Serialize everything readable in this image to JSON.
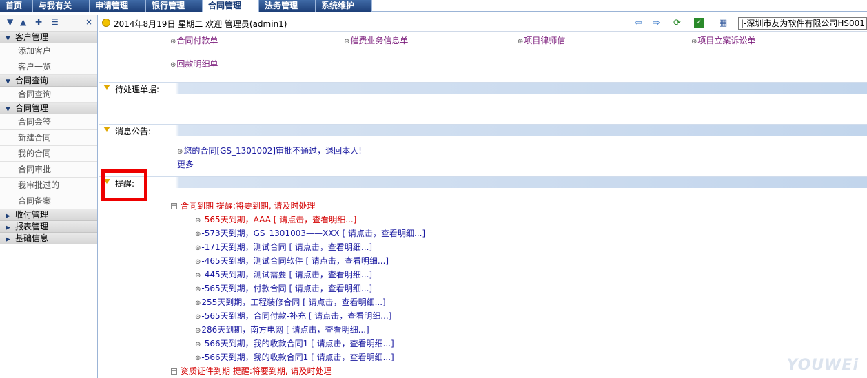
{
  "topnav": {
    "tabs": [
      {
        "label": "首页"
      },
      {
        "label": "与我有关"
      },
      {
        "label": "申请管理"
      },
      {
        "label": "银行管理"
      },
      {
        "label": "合同管理",
        "active": true
      },
      {
        "label": "法务管理"
      },
      {
        "label": "系统维护"
      }
    ]
  },
  "sidebar": {
    "toolbar_close": "×",
    "groups": [
      {
        "title": "客户管理",
        "expanded": true,
        "items": [
          "添加客户",
          "客户一览"
        ]
      },
      {
        "title": "合同查询",
        "expanded": true,
        "items": [
          "合同查询"
        ]
      },
      {
        "title": "合同管理",
        "expanded": true,
        "items": [
          "合同会签",
          "新建合同",
          "我的合同",
          "合同审批",
          "我审批过的",
          "合同备案"
        ]
      },
      {
        "title": "收付管理",
        "expanded": false,
        "items": []
      },
      {
        "title": "报表管理",
        "expanded": false,
        "items": []
      },
      {
        "title": "基础信息",
        "expanded": false,
        "items": []
      }
    ]
  },
  "infobar": {
    "date_text": "2014年8月19日 星期二 欢迎 管理员(admin1)",
    "company": "|-深圳市友为软件有限公司HS001"
  },
  "quick_links": [
    "合同付款单",
    "催费业务信息单",
    "项目律师信",
    "项目立案诉讼单",
    "回款明细单"
  ],
  "sections": {
    "pending": "待处理单据:",
    "notice": "消息公告:",
    "remind": "提醒:"
  },
  "notices": {
    "item": "您的合同[GS_1301002]审批不通过，退回本人!",
    "more": "更多"
  },
  "reminders": {
    "contract_group": "合同到期  提醒:将要到期, 请及时处理",
    "contract_items": [
      "-565天到期，AAA [ 请点击，查看明细...]",
      "-573天到期，GS_1301003——XXX [ 请点击，查看明细...]",
      "-171天到期，测试合同 [ 请点击，查看明细...]",
      "-465天到期，测试合同软件 [ 请点击，查看明细...]",
      "-445天到期，测试需要 [ 请点击，查看明细...]",
      "-565天到期，付款合同 [ 请点击，查看明细...]",
      "255天到期，工程装修合同 [ 请点击，查看明细...]",
      "-565天到期，合同付款-补充 [ 请点击，查看明细...]",
      "286天到期，南方电网 [ 请点击，查看明细...]",
      "-566天到期，我的收款合同1 [ 请点击，查看明细...]",
      "-566天到期，我的收款合同1 [ 请点击，查看明细...]"
    ],
    "cert_group": "资质证件到期  提醒:将要到期, 请及时处理"
  },
  "watermark": "YOUWEi"
}
